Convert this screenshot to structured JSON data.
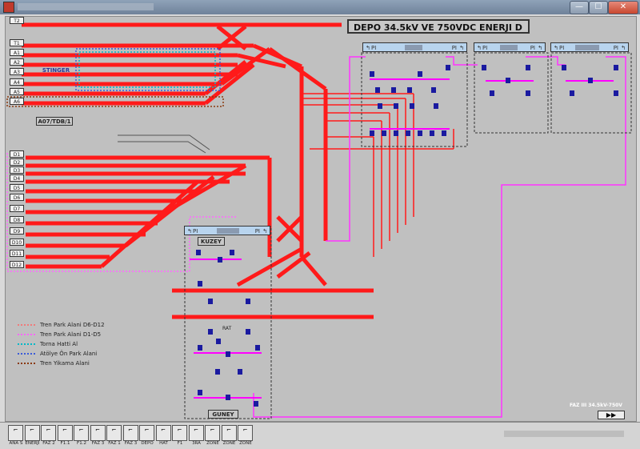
{
  "window": {
    "min_glyph": "—",
    "max_glyph": "☐",
    "close_glyph": "✕"
  },
  "title": "DEPO 34.5kV VE 750VDC ENERJI D",
  "track_labels": [
    "T2",
    "T1",
    "A1",
    "A2",
    "A3",
    "A4",
    "A5",
    "A6",
    "D1",
    "D2",
    "D3",
    "D4",
    "D5",
    "D6",
    "D7",
    "D8",
    "D9",
    "D10",
    "D11",
    "D12"
  ],
  "box_label": "A07/TDB/1",
  "box_label_2": "STINGER",
  "panels": [
    {
      "left_arrow": "↰",
      "left_tag": "PI",
      "right_tag": "PI",
      "right_arrow": "↰"
    },
    {
      "left_arrow": "↰",
      "left_tag": "PI",
      "right_tag": "PI",
      "right_arrow": "↰"
    },
    {
      "left_arrow": "↰",
      "left_tag": "PI",
      "right_tag": "PI",
      "right_arrow": "↰"
    },
    {
      "left_arrow": "↰",
      "left_tag": "PI",
      "right_tag": "PI",
      "right_arrow": "↰"
    }
  ],
  "kuzey": "KUZEY",
  "guney": "GUNEY",
  "rat": "RAT",
  "legend": [
    {
      "label": "Tren Park Alani D6-D12",
      "color": "#f07a7a"
    },
    {
      "label": "Tren Park Alani D1-D5",
      "color": "#ff66ff"
    },
    {
      "label": "Torna Hatti Al",
      "color": "#00b8c8"
    },
    {
      "label": "Atölye Ön Park Alani",
      "color": "#3a5bd9"
    },
    {
      "label": "Tren Yikama Alani",
      "color": "#8a3a10"
    }
  ],
  "faz_label": "FAZ III 34.5kV-750V",
  "ff_button": "▶▶",
  "nav": [
    {
      "label": "ANA S"
    },
    {
      "label": "ENERJI"
    },
    {
      "label": "FAZ 2"
    },
    {
      "label": "F1.1"
    },
    {
      "label": "F1.2"
    },
    {
      "label": "FAZ 3"
    },
    {
      "label": "FAZ 1"
    },
    {
      "label": "FAZ 3"
    },
    {
      "label": "DEPO"
    },
    {
      "label": "HAT"
    },
    {
      "label": "F1"
    },
    {
      "label": "3RA"
    },
    {
      "label": "ZONE"
    },
    {
      "label": "ZONE"
    },
    {
      "label": "ZONE"
    }
  ],
  "colors": {
    "track": "#ff1a1a",
    "cable": "#ff33ff",
    "breaker": "#1a1aa0",
    "bus": "#ff00ff"
  }
}
